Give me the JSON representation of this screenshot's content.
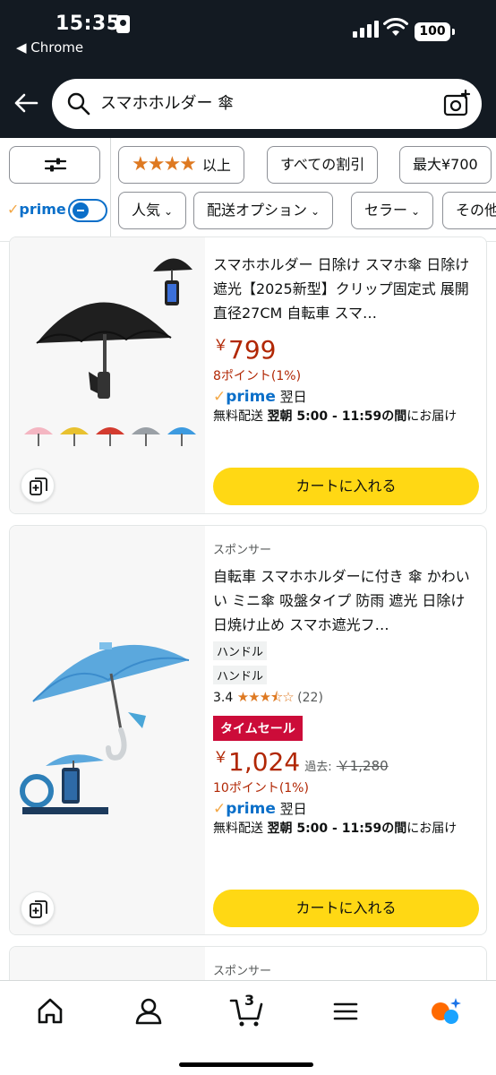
{
  "status_bar": {
    "time": "15:35",
    "back_app": "◀ Chrome",
    "battery": "100"
  },
  "search": {
    "query": "スマホホルダー 傘"
  },
  "filters": {
    "prime_label": "prime",
    "chips_row1": [
      "以上",
      "すべての割引",
      "最大¥700"
    ],
    "chips_row2": [
      "人気",
      "配送オプション",
      "セラー",
      "その他"
    ]
  },
  "products": [
    {
      "title": "スマホホルダー 日除け スマホ傘 日除け 遮光【2025新型】クリップ固定式 展開直径27CM 自転車 スマ…",
      "price_symbol": "￥",
      "price": "799",
      "points": "8ポイント(1%)",
      "prime_day": "翌日",
      "delivery_prefix": "無料配送 ",
      "delivery_bold": "翌朝 5:00 - 11:59の間",
      "delivery_suffix": "にお届け",
      "cart_label": "カートに入れる",
      "swatch_colors": [
        "#f4b6c2",
        "#e8c12f",
        "#d33b2f",
        "#9aa0a6",
        "#3d9be0"
      ]
    },
    {
      "sponsored": "スポンサー",
      "title": "自転車 スマホホルダーに付き 傘 かわいい ミニ傘 吸盤タイプ 防雨 遮光 日除け 日焼け止め スマホ遮光フ…",
      "tags": [
        "ハンドル",
        "ハンドル"
      ],
      "rating": "3.4",
      "rating_stars": "★★★⯪☆",
      "reviews": "(22)",
      "deal": "タイムセール",
      "price_symbol": "￥",
      "price": "1,024",
      "was_label": "過去:",
      "was_price": "￥1,280",
      "points": "10ポイント(1%)",
      "prime_day": "翌日",
      "delivery_prefix": "無料配送 ",
      "delivery_bold": "翌朝 5:00 - 11:59の間",
      "delivery_suffix": "にお届け",
      "cart_label": "カートに入れる"
    },
    {
      "sponsored": "スポンサー"
    }
  ],
  "bottom_nav": {
    "cart_count": "3"
  },
  "colors": {
    "header": "#131a22",
    "price": "#b12704",
    "prime": "#0b6fc9",
    "cart_button": "#ffd814",
    "deal": "#cc0c39",
    "star": "#de7921"
  }
}
